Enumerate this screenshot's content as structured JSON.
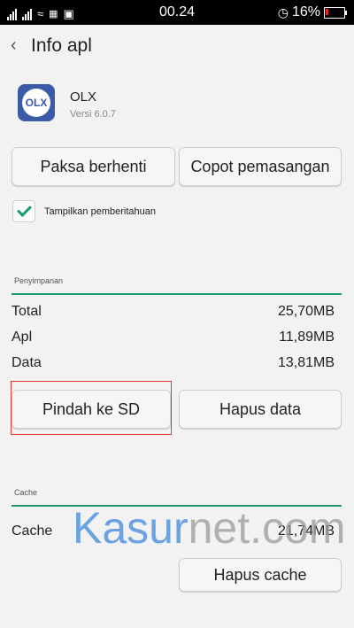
{
  "status_bar": {
    "time": "00.24",
    "battery": "16%"
  },
  "header": {
    "title": "Info apl"
  },
  "app": {
    "name": "OLX",
    "version": "Versi 6.0.7",
    "icon_text": "OLX"
  },
  "actions": {
    "force_stop": "Paksa berhenti",
    "uninstall": "Copot pemasangan"
  },
  "notifications": {
    "label": "Tampilkan pemberitahuan",
    "checked": true
  },
  "storage": {
    "section_label": "Penyimpanan",
    "rows": [
      {
        "label": "Total",
        "value": "25,70MB"
      },
      {
        "label": "Apl",
        "value": "11,89MB"
      },
      {
        "label": "Data",
        "value": "13,81MB"
      }
    ],
    "move_to_sd": "Pindah ke SD",
    "clear_data": "Hapus data"
  },
  "cache": {
    "section_label": "Cache",
    "label": "Cache",
    "value": "21,74MB",
    "clear_cache": "Hapus cache"
  },
  "watermark": {
    "part1": "Kasur",
    "part2": "net.com"
  },
  "colors": {
    "accent": "#1a9b73",
    "highlight": "#e53935",
    "status_bar": "#000000"
  }
}
